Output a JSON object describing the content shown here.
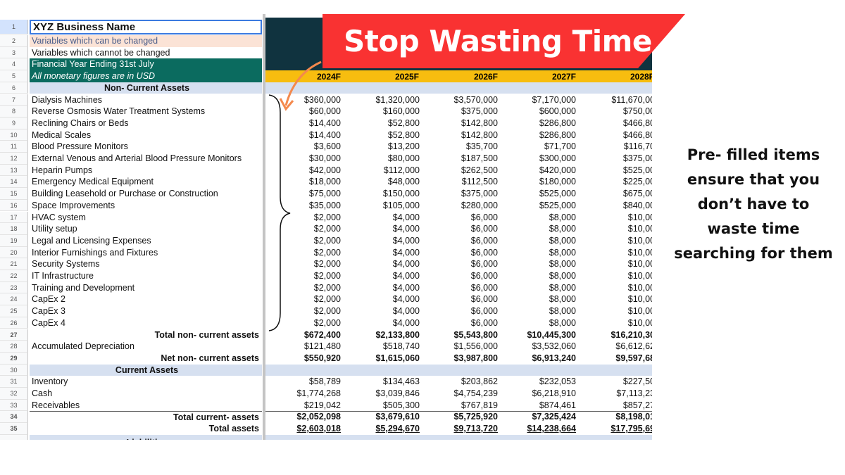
{
  "header": {
    "business_name": "XYZ Business Name",
    "legend_changeable": "Variables which can be changed",
    "legend_fixed": "Variables which cannot be changed",
    "financial_year": "Financial Year Ending 31st July",
    "currency_note": "All monetary figures are in USD",
    "years": [
      "2024F",
      "2025F",
      "2026F",
      "2027F",
      "2028F"
    ]
  },
  "banner": {
    "text": "Stop Wasting Time",
    "color": "#f93232"
  },
  "note": {
    "lines": [
      "Pre- filled items",
      "ensure that you",
      "don’t have to",
      "waste time",
      "searching for them"
    ]
  },
  "colors": {
    "dark_header": "#10333f",
    "year_band": "#f7bd0f",
    "teal": "#0b6b5f",
    "section": "#d6e0f0",
    "changeable": "#fbe3d6",
    "arrow": "#f4894d"
  },
  "rows": [
    {
      "n": "6",
      "label": "Non- Current Assets",
      "style": "sec",
      "values": []
    },
    {
      "n": "7",
      "label": "Dialysis Machines",
      "values": [
        "$360,000",
        "$1,320,000",
        "$3,570,000",
        "$7,170,000",
        "$11,670,00"
      ]
    },
    {
      "n": "8",
      "label": "Reverse Osmosis Water Treatment Systems",
      "values": [
        "$60,000",
        "$160,000",
        "$375,000",
        "$600,000",
        "$750,00"
      ]
    },
    {
      "n": "9",
      "label": "Reclining Chairs or Beds",
      "values": [
        "$14,400",
        "$52,800",
        "$142,800",
        "$286,800",
        "$466,80"
      ]
    },
    {
      "n": "10",
      "label": "Medical Scales",
      "values": [
        "$14,400",
        "$52,800",
        "$142,800",
        "$286,800",
        "$466,80"
      ]
    },
    {
      "n": "11",
      "label": "Blood Pressure Monitors",
      "values": [
        "$3,600",
        "$13,200",
        "$35,700",
        "$71,700",
        "$116,70"
      ]
    },
    {
      "n": "12",
      "label": "External Venous and Arterial Blood Pressure Monitors",
      "values": [
        "$30,000",
        "$80,000",
        "$187,500",
        "$300,000",
        "$375,00"
      ]
    },
    {
      "n": "13",
      "label": "Heparin Pumps",
      "values": [
        "$42,000",
        "$112,000",
        "$262,500",
        "$420,000",
        "$525,00"
      ]
    },
    {
      "n": "14",
      "label": "Emergency Medical Equipment",
      "values": [
        "$18,000",
        "$48,000",
        "$112,500",
        "$180,000",
        "$225,00"
      ]
    },
    {
      "n": "15",
      "label": "Building Leasehold or Purchase or Construction",
      "values": [
        "$75,000",
        "$150,000",
        "$375,000",
        "$525,000",
        "$675,00"
      ]
    },
    {
      "n": "16",
      "label": "Space Improvements",
      "values": [
        "$35,000",
        "$105,000",
        "$280,000",
        "$525,000",
        "$840,00"
      ]
    },
    {
      "n": "17",
      "label": "HVAC system",
      "values": [
        "$2,000",
        "$4,000",
        "$6,000",
        "$8,000",
        "$10,00"
      ]
    },
    {
      "n": "18",
      "label": "Utility setup",
      "values": [
        "$2,000",
        "$4,000",
        "$6,000",
        "$8,000",
        "$10,00"
      ]
    },
    {
      "n": "19",
      "label": "Legal and Licensing Expenses",
      "values": [
        "$2,000",
        "$4,000",
        "$6,000",
        "$8,000",
        "$10,00"
      ]
    },
    {
      "n": "20",
      "label": "Interior Furnishings and Fixtures",
      "values": [
        "$2,000",
        "$4,000",
        "$6,000",
        "$8,000",
        "$10,00"
      ]
    },
    {
      "n": "21",
      "label": "Security Systems",
      "values": [
        "$2,000",
        "$4,000",
        "$6,000",
        "$8,000",
        "$10,00"
      ]
    },
    {
      "n": "22",
      "label": "IT Infrastructure",
      "values": [
        "$2,000",
        "$4,000",
        "$6,000",
        "$8,000",
        "$10,00"
      ]
    },
    {
      "n": "23",
      "label": "Training and Development",
      "values": [
        "$2,000",
        "$4,000",
        "$6,000",
        "$8,000",
        "$10,00"
      ]
    },
    {
      "n": "24",
      "label": "CapEx 2",
      "values": [
        "$2,000",
        "$4,000",
        "$6,000",
        "$8,000",
        "$10,00"
      ]
    },
    {
      "n": "25",
      "label": "CapEx 3",
      "values": [
        "$2,000",
        "$4,000",
        "$6,000",
        "$8,000",
        "$10,00"
      ]
    },
    {
      "n": "26",
      "label": "CapEx 4",
      "values": [
        "$2,000",
        "$4,000",
        "$6,000",
        "$8,000",
        "$10,00"
      ]
    },
    {
      "n": "27",
      "label": "Total non- current assets",
      "style": "bold right",
      "values": [
        "$672,400",
        "$2,133,800",
        "$5,543,800",
        "$10,445,300",
        "$16,210,30"
      ]
    },
    {
      "n": "28",
      "label": "Accumulated Depreciation",
      "values": [
        "$121,480",
        "$518,740",
        "$1,556,000",
        "$3,532,060",
        "$6,612,62"
      ]
    },
    {
      "n": "29",
      "label": "Net non- current assets",
      "style": "bold right",
      "values": [
        "$550,920",
        "$1,615,060",
        "$3,987,800",
        "$6,913,240",
        "$9,597,68"
      ]
    },
    {
      "n": "30",
      "label": "Current Assets",
      "style": "sec",
      "values": []
    },
    {
      "n": "31",
      "label": "Inventory",
      "values": [
        "$58,789",
        "$134,463",
        "$203,862",
        "$232,053",
        "$227,50"
      ]
    },
    {
      "n": "32",
      "label": "Cash",
      "values": [
        "$1,774,268",
        "$3,039,846",
        "$4,754,239",
        "$6,218,910",
        "$7,113,23"
      ]
    },
    {
      "n": "33",
      "label": "Receivables",
      "values": [
        "$219,042",
        "$505,300",
        "$767,819",
        "$874,461",
        "$857,27"
      ]
    },
    {
      "n": "34",
      "label": "Total current- assets",
      "style": "bold right topline",
      "values": [
        "$2,052,098",
        "$3,679,610",
        "$5,725,920",
        "$7,325,424",
        "$8,198,01"
      ]
    },
    {
      "n": "35",
      "label": "Total assets",
      "style": "bold right ul",
      "values": [
        "$2,603,018",
        "$5,294,670",
        "$9,713,720",
        "$14,238,664",
        "$17,795,69"
      ]
    },
    {
      "n": "36",
      "label": "Liabilities",
      "style": "sec",
      "values": []
    }
  ]
}
